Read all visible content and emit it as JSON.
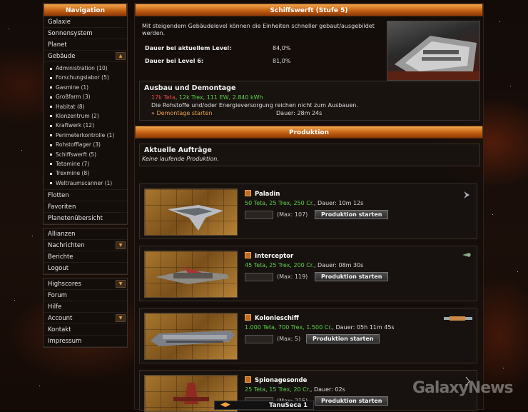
{
  "navigation": {
    "title": "Navigation",
    "items_top": [
      "Galaxie",
      "Sonnensystem",
      "Planet"
    ],
    "gebaeude_label": "Gebäude",
    "gebaeude_sub": [
      "Administration (10)",
      "Forschungslabor (5)",
      "Gasmine (1)",
      "Großfarm (3)",
      "Habitat (8)",
      "Klonzentrum (2)",
      "Kraftwerk (12)",
      "Perimeterkontrolle (1)",
      "Rohstofflager (3)",
      "Schiffswerft (5)",
      "Tetamine (7)",
      "Trexmine (8)",
      "Weltraumscanner (1)"
    ],
    "items_after": [
      "Flotten",
      "Favoriten",
      "Planetenübersicht"
    ],
    "group2": [
      "Allianzen",
      "Nachrichten",
      "Berichte",
      "Logout"
    ],
    "group3": [
      "Highscores",
      "Forum",
      "Hilfe",
      "Account",
      "Kontakt",
      "Impressum"
    ]
  },
  "shipyard": {
    "title": "Schiffswerft (Stufe 5)",
    "intro": "Mit steigendem Gebäudelevel können die Einheiten schneller gebaut/ausgebildet werden.",
    "current_label": "Dauer bei aktuellem Level:",
    "current_value": "84,0%",
    "next_label": "Dauer bei Level 6:",
    "next_value": "81,0%",
    "upgrade_title": "Ausbau und Demontage",
    "upgrade_cost_red": "17k Teta",
    "upgrade_cost_green": ", 12k Trex, 111 EW, 2.840 kWh",
    "upgrade_note": "Die Rohstoffe und/oder Energieversorgung reichen nicht zum Ausbauen.",
    "demolish_link": "» Demontage starten",
    "demolish_duration": "Dauer: 28m 24s"
  },
  "production": {
    "title": "Produktion",
    "orders_title": "Aktuelle Aufträge",
    "orders_empty": "Keine laufende Produktion.",
    "button_label": "Produktion starten",
    "ships": [
      {
        "name": "Paladin",
        "cost": "50 Teta, 25 Trex, 250 Cr.",
        "duration": ", Dauer: 10m 12s",
        "max": "(Max: 107)"
      },
      {
        "name": "Interceptor",
        "cost": "45 Teta, 25 Trex, 200 Cr.",
        "duration": ", Dauer: 08m 30s",
        "max": "(Max: 119)"
      },
      {
        "name": "Kolonieschiff",
        "cost": "1.000 Teta, 700 Trex, 1.500 Cr.",
        "duration": ", Dauer: 05h 11m 45s",
        "max": "(Max: 5)"
      },
      {
        "name": "Spionagesonde",
        "cost": "25 Teta, 15 Trex, 20 Cr.",
        "duration": ", Dauer: 02s",
        "max": "(Max: 215)"
      }
    ]
  },
  "footer": {
    "planet": "TanuSeca 1"
  },
  "watermark": "GalaxyNews",
  "colors": {
    "header": "#c25f12",
    "green": "#5bd24a",
    "red": "#e24a3a",
    "orange": "#e8a24a"
  }
}
